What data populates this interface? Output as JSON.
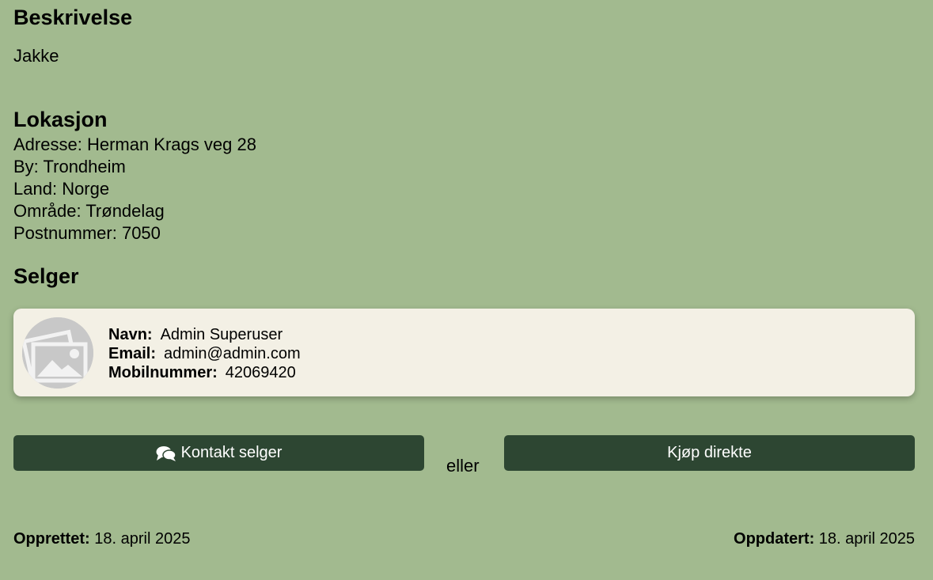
{
  "description": {
    "heading": "Beskrivelse",
    "text": "Jakke"
  },
  "location": {
    "heading": "Lokasjon",
    "address_label": "Adresse:",
    "address": "Herman Krags veg 28",
    "city_label": "By:",
    "city": "Trondheim",
    "country_label": "Land:",
    "country": "Norge",
    "region_label": "Område:",
    "region": "Trøndelag",
    "postal_label": "Postnummer:",
    "postal": "7050"
  },
  "seller": {
    "heading": "Selger",
    "avatar_icon": "image-placeholder-icon",
    "name_label": "Navn:",
    "name": "Admin Superuser",
    "email_label": "Email:",
    "email": "admin@admin.com",
    "phone_label": "Mobilnummer:",
    "phone": "42069420"
  },
  "actions": {
    "contact_label": "Kontakt selger",
    "contact_icon": "chat-bubbles-icon",
    "or_text": "eller",
    "buy_label": "Kjøp direkte"
  },
  "meta": {
    "created_label": "Opprettet:",
    "created": "18. april 2025",
    "updated_label": "Oppdatert:",
    "updated": "18. april 2025"
  },
  "colors": {
    "background": "#a2ba8f",
    "card": "#f3f0e5",
    "button": "#2d4632"
  }
}
